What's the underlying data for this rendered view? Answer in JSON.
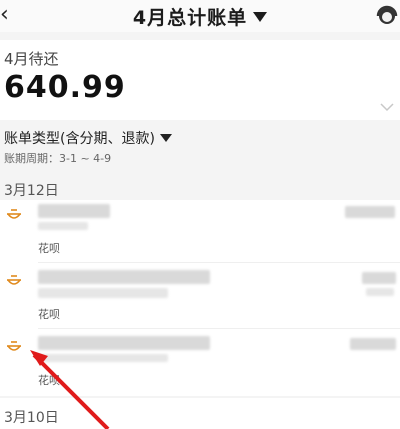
{
  "header": {
    "title": "4月总计账单",
    "back_icon": "back-arrow-icon",
    "service_icon": "customer-service-icon"
  },
  "summary": {
    "label": "4月待还",
    "amount": "640.99"
  },
  "filter": {
    "type_label": "账单类型(含分期、退款)",
    "cycle_label": "账期周期：3-1 ~ 4-9"
  },
  "groups": [
    {
      "date": "3月12日",
      "items": [
        {
          "tag": "花呗"
        },
        {
          "tag": "花呗"
        },
        {
          "tag": "花呗"
        }
      ]
    },
    {
      "date": "3月10日"
    }
  ],
  "colors": {
    "accent": "#e08a1e",
    "annotation": "#e01b1b"
  }
}
